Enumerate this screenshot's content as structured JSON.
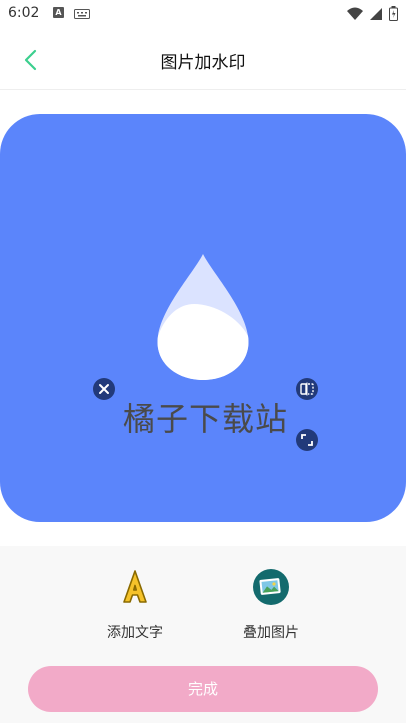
{
  "status_bar": {
    "time": "6:02",
    "notif_letter": "A"
  },
  "header": {
    "title": "图片加水印"
  },
  "canvas": {
    "background_color": "#5b85fb",
    "watermark_text": "橘子下载站"
  },
  "tools": {
    "add_text_label": "添加文字",
    "overlay_image_label": "叠加图片"
  },
  "actions": {
    "done_label": "完成"
  },
  "colors": {
    "accent_green": "#3ccf8e",
    "done_button": "#f2aac8",
    "control_dark": "#223a7a"
  }
}
